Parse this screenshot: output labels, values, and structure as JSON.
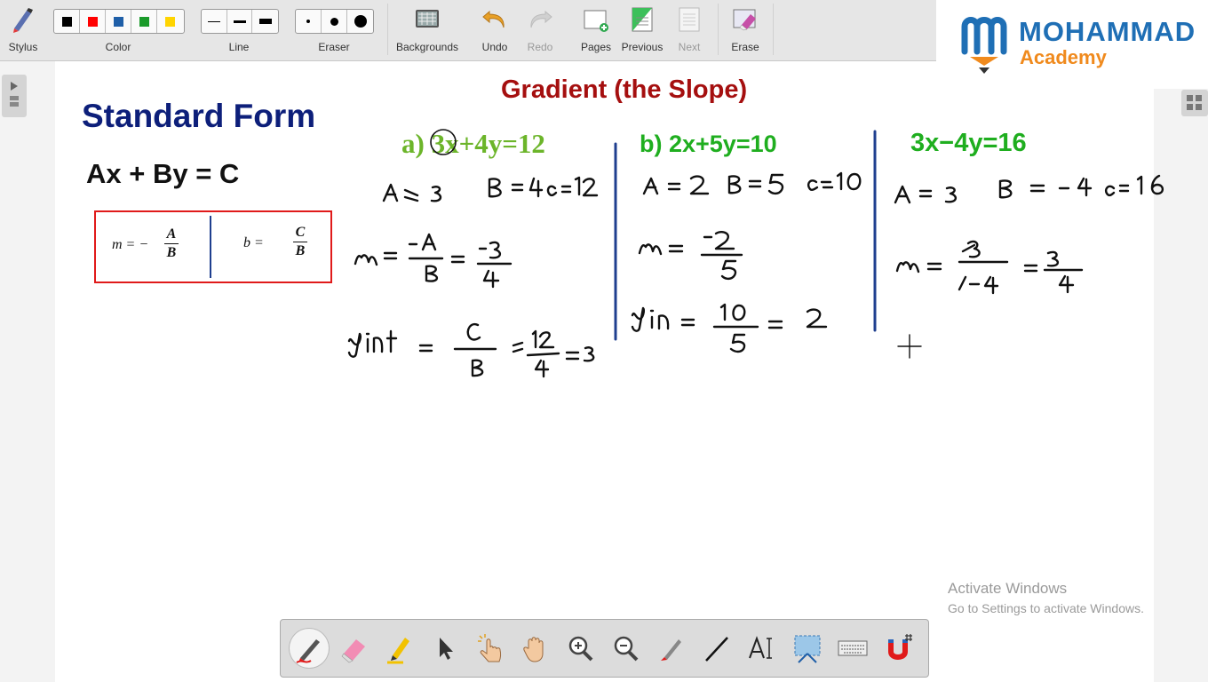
{
  "toolbar": {
    "stylus": "Stylus",
    "color": "Color",
    "line": "Line",
    "eraser": "Eraser",
    "backgrounds": "Backgrounds",
    "undo": "Undo",
    "redo": "Redo",
    "pages": "Pages",
    "previous": "Previous",
    "next": "Next",
    "erase": "Erase",
    "colors": [
      "#000000",
      "#ff0000",
      "#1f5fa8",
      "#1a9a2a",
      "#ffd400"
    ]
  },
  "logo": {
    "line1": "MOHAMMAD",
    "line2": "Academy"
  },
  "page": {
    "title": "Gradient (the Slope)",
    "standard_form_heading": "Standard Form",
    "standard_form_eq": "Ax + By = C",
    "formula_m": "m = −",
    "formula_b": "b =",
    "formula_A": "A",
    "formula_B": "B",
    "formula_C": "C",
    "eq_a": "a) 3x+4y=12",
    "eq_b": "b) 2x+5y=10",
    "eq_c": "3x−4y=16"
  },
  "watermark": {
    "line1": "Activate Windows",
    "line2": "Go to Settings to activate Windows."
  },
  "dock_tools": [
    "pen-icon",
    "eraser-icon",
    "highlighter-icon",
    "select-arrow-icon",
    "pointer-hand-icon",
    "pan-hand-icon",
    "zoom-in-icon",
    "zoom-out-icon",
    "laser-pen-icon",
    "line-icon",
    "text-icon",
    "screen-clip-icon",
    "keyboard-icon",
    "magnet-icon"
  ],
  "colors": {
    "title_red": "#a50f0f",
    "navy": "#0d1f7a",
    "green": "#1fae1f",
    "olive_green": "#6cb52a"
  }
}
